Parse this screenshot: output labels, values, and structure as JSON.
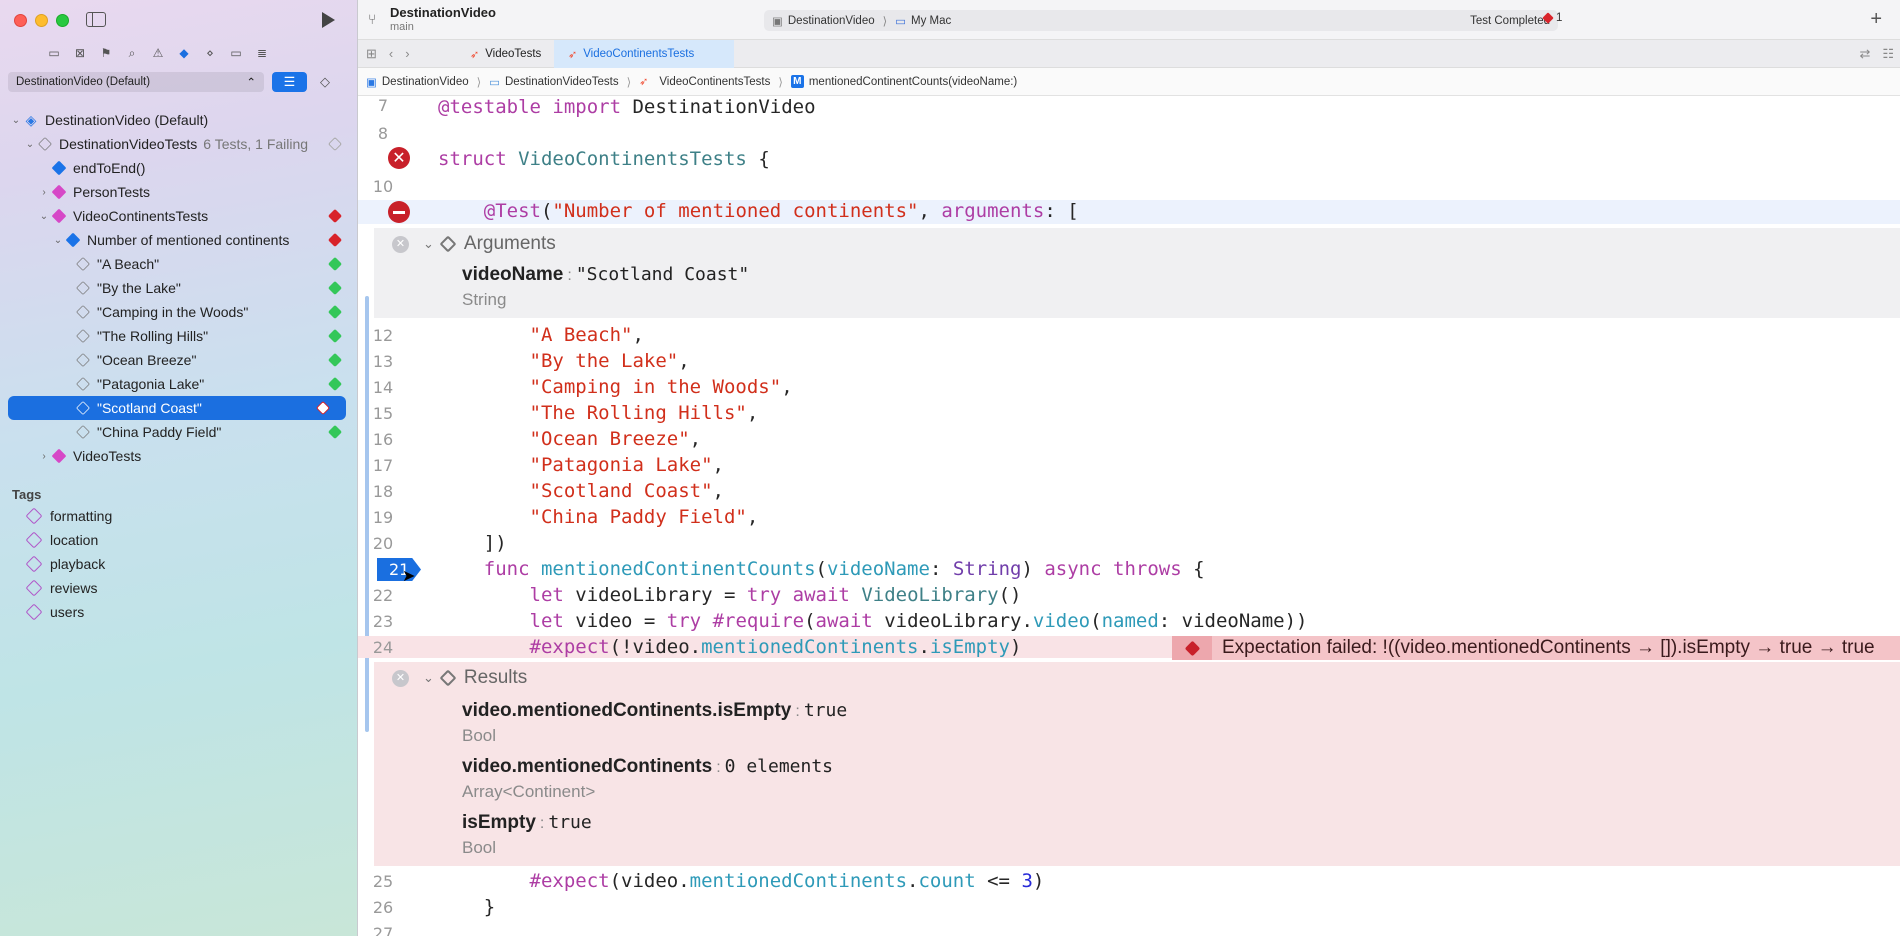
{
  "sidebar": {
    "scheme": "DestinationVideo (Default)",
    "tree": [
      {
        "label": "DestinationVideo (Default)",
        "sub": "",
        "level": 0,
        "disclosure": "open",
        "icon": "project-icon",
        "status": "",
        "selected": false
      },
      {
        "label": "DestinationVideoTests",
        "sub": "6 Tests, 1 Failing",
        "level": 1,
        "disclosure": "open",
        "icon": "test-bundle-icon",
        "status": "gray",
        "selected": false
      },
      {
        "label": "endToEnd()",
        "sub": "",
        "level": 2,
        "disclosure": "",
        "icon": "diamond-blue",
        "status": "",
        "selected": false
      },
      {
        "label": "PersonTests",
        "sub": "",
        "level": 2,
        "disclosure": "closed",
        "icon": "diamond-pink",
        "status": "",
        "selected": false
      },
      {
        "label": "VideoContinentsTests",
        "sub": "",
        "level": 2,
        "disclosure": "open",
        "icon": "diamond-pink",
        "status": "fail",
        "selected": false
      },
      {
        "label": "Number of mentioned continents",
        "sub": "",
        "level": 3,
        "disclosure": "open",
        "icon": "diamond-blue",
        "status": "fail",
        "selected": false
      },
      {
        "label": "\"A Beach\"",
        "sub": "",
        "level": 4,
        "disclosure": "",
        "icon": "diamond-gray",
        "status": "pass",
        "selected": false
      },
      {
        "label": "\"By the Lake\"",
        "sub": "",
        "level": 4,
        "disclosure": "",
        "icon": "diamond-gray",
        "status": "pass",
        "selected": false
      },
      {
        "label": "\"Camping in the Woods\"",
        "sub": "",
        "level": 4,
        "disclosure": "",
        "icon": "diamond-gray",
        "status": "pass",
        "selected": false
      },
      {
        "label": "\"The Rolling Hills\"",
        "sub": "",
        "level": 4,
        "disclosure": "",
        "icon": "diamond-gray",
        "status": "pass",
        "selected": false
      },
      {
        "label": "\"Ocean Breeze\"",
        "sub": "",
        "level": 4,
        "disclosure": "",
        "icon": "diamond-gray",
        "status": "pass",
        "selected": false
      },
      {
        "label": "\"Patagonia Lake\"",
        "sub": "",
        "level": 4,
        "disclosure": "",
        "icon": "diamond-gray",
        "status": "pass",
        "selected": false
      },
      {
        "label": "\"Scotland Coast\"",
        "sub": "",
        "level": 4,
        "disclosure": "",
        "icon": "diamond-gray",
        "status": "fail-white",
        "selected": true
      },
      {
        "label": "\"China Paddy Field\"",
        "sub": "",
        "level": 4,
        "disclosure": "",
        "icon": "diamond-gray",
        "status": "pass",
        "selected": false
      },
      {
        "label": "VideoTests",
        "sub": "",
        "level": 2,
        "disclosure": "closed",
        "icon": "diamond-pink",
        "status": "",
        "selected": false
      }
    ],
    "tags_title": "Tags",
    "tags": [
      "formatting",
      "location",
      "playback",
      "reviews",
      "users"
    ]
  },
  "toolbar": {
    "project": "DestinationVideo",
    "branch": "main",
    "scheme": "DestinationVideo",
    "destination": "My Mac",
    "status": "Test Completed",
    "error_count": "1"
  },
  "tabs": [
    "VideoTests",
    "VideoContinentsTests"
  ],
  "breadcrumb": [
    "DestinationVideo",
    "DestinationVideoTests",
    "VideoContinentsTests",
    "mentionedContinentCounts(videoName:)"
  ],
  "editor": {
    "line_numbers": {
      "l7": "7",
      "l8": "8",
      "l9": "",
      "l10": "10",
      "l11": "",
      "l12": "12",
      "l13": "13",
      "l14": "14",
      "l15": "15",
      "l16": "16",
      "l17": "17",
      "l18": "18",
      "l19": "19",
      "l20": "20",
      "l21": "21",
      "l22": "22",
      "l23": "23",
      "l24": "24",
      "l25": "25",
      "l26": "26",
      "l27": "27"
    },
    "arguments_panel": {
      "title": "Arguments",
      "name": "videoName",
      "value": "\"Scotland Coast\"",
      "type": "String"
    },
    "results_panel": {
      "title": "Results",
      "items": [
        {
          "name": "video.mentionedContinents.isEmpty",
          "value": "true",
          "type": "Bool"
        },
        {
          "name": "video.mentionedContinents",
          "value": "0 elements",
          "type": "Array<Continent>"
        },
        {
          "name": "isEmpty",
          "value": "true",
          "type": "Bool"
        }
      ]
    },
    "error_message": "Expectation failed: !((video.mentionedContinents → []).isEmpty → true → true"
  }
}
